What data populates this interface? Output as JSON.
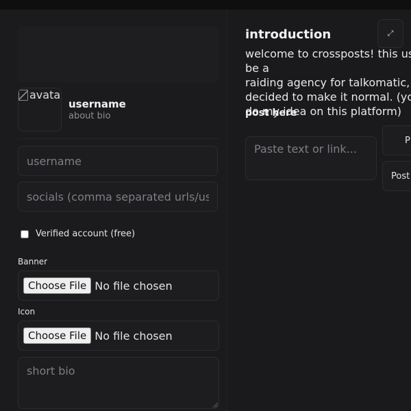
{
  "profile_editor": {
    "avatar_alt": "avatar",
    "display_name": "username",
    "display_bio": "about bio",
    "username_placeholder": "username",
    "socials_placeholder": "socials (comma separated urls/usernames)",
    "verified_label": "Verified account (free)",
    "banner_label": "Banner",
    "icon_label": "Icon",
    "choose_file_label": "Choose File",
    "no_file_text": "No file chosen",
    "bio_placeholder": "short bio"
  },
  "feed": {
    "title": "introduction",
    "expand_icon": "expand-icon",
    "text": "welcome to crossposts! this used to be a\nraiding agency for talkomatic, but i\ndecided to make it normal. (you can\ndo my idea on this platform)",
    "post_heading": "post here",
    "post_placeholder": "Paste text or link...",
    "button_primary_label": "P",
    "button_secondary_label": "Post"
  }
}
